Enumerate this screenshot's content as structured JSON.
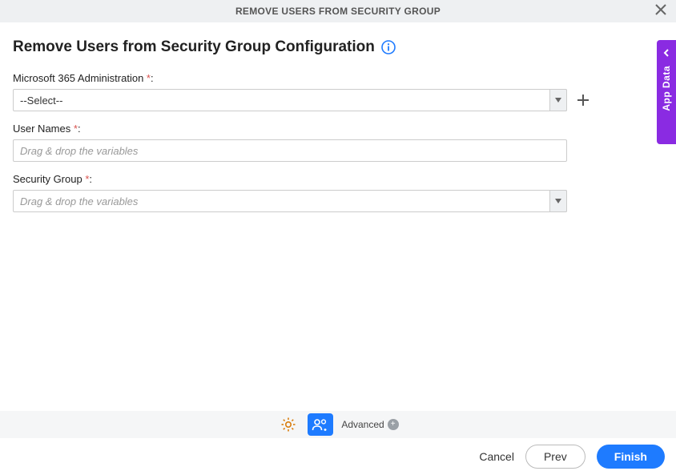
{
  "header": {
    "title": "REMOVE USERS FROM SECURITY GROUP"
  },
  "page": {
    "title": "Remove Users from Security Group Configuration"
  },
  "fields": {
    "admin": {
      "label": "Microsoft 365 Administration",
      "value": "--Select--"
    },
    "userNames": {
      "label": "User Names",
      "placeholder": "Drag & drop the variables"
    },
    "securityGroup": {
      "label": "Security Group",
      "placeholder": "Drag & drop the variables"
    }
  },
  "sidePanel": {
    "label": "App Data"
  },
  "footer": {
    "advanced": "Advanced",
    "cancel": "Cancel",
    "prev": "Prev",
    "finish": "Finish"
  }
}
